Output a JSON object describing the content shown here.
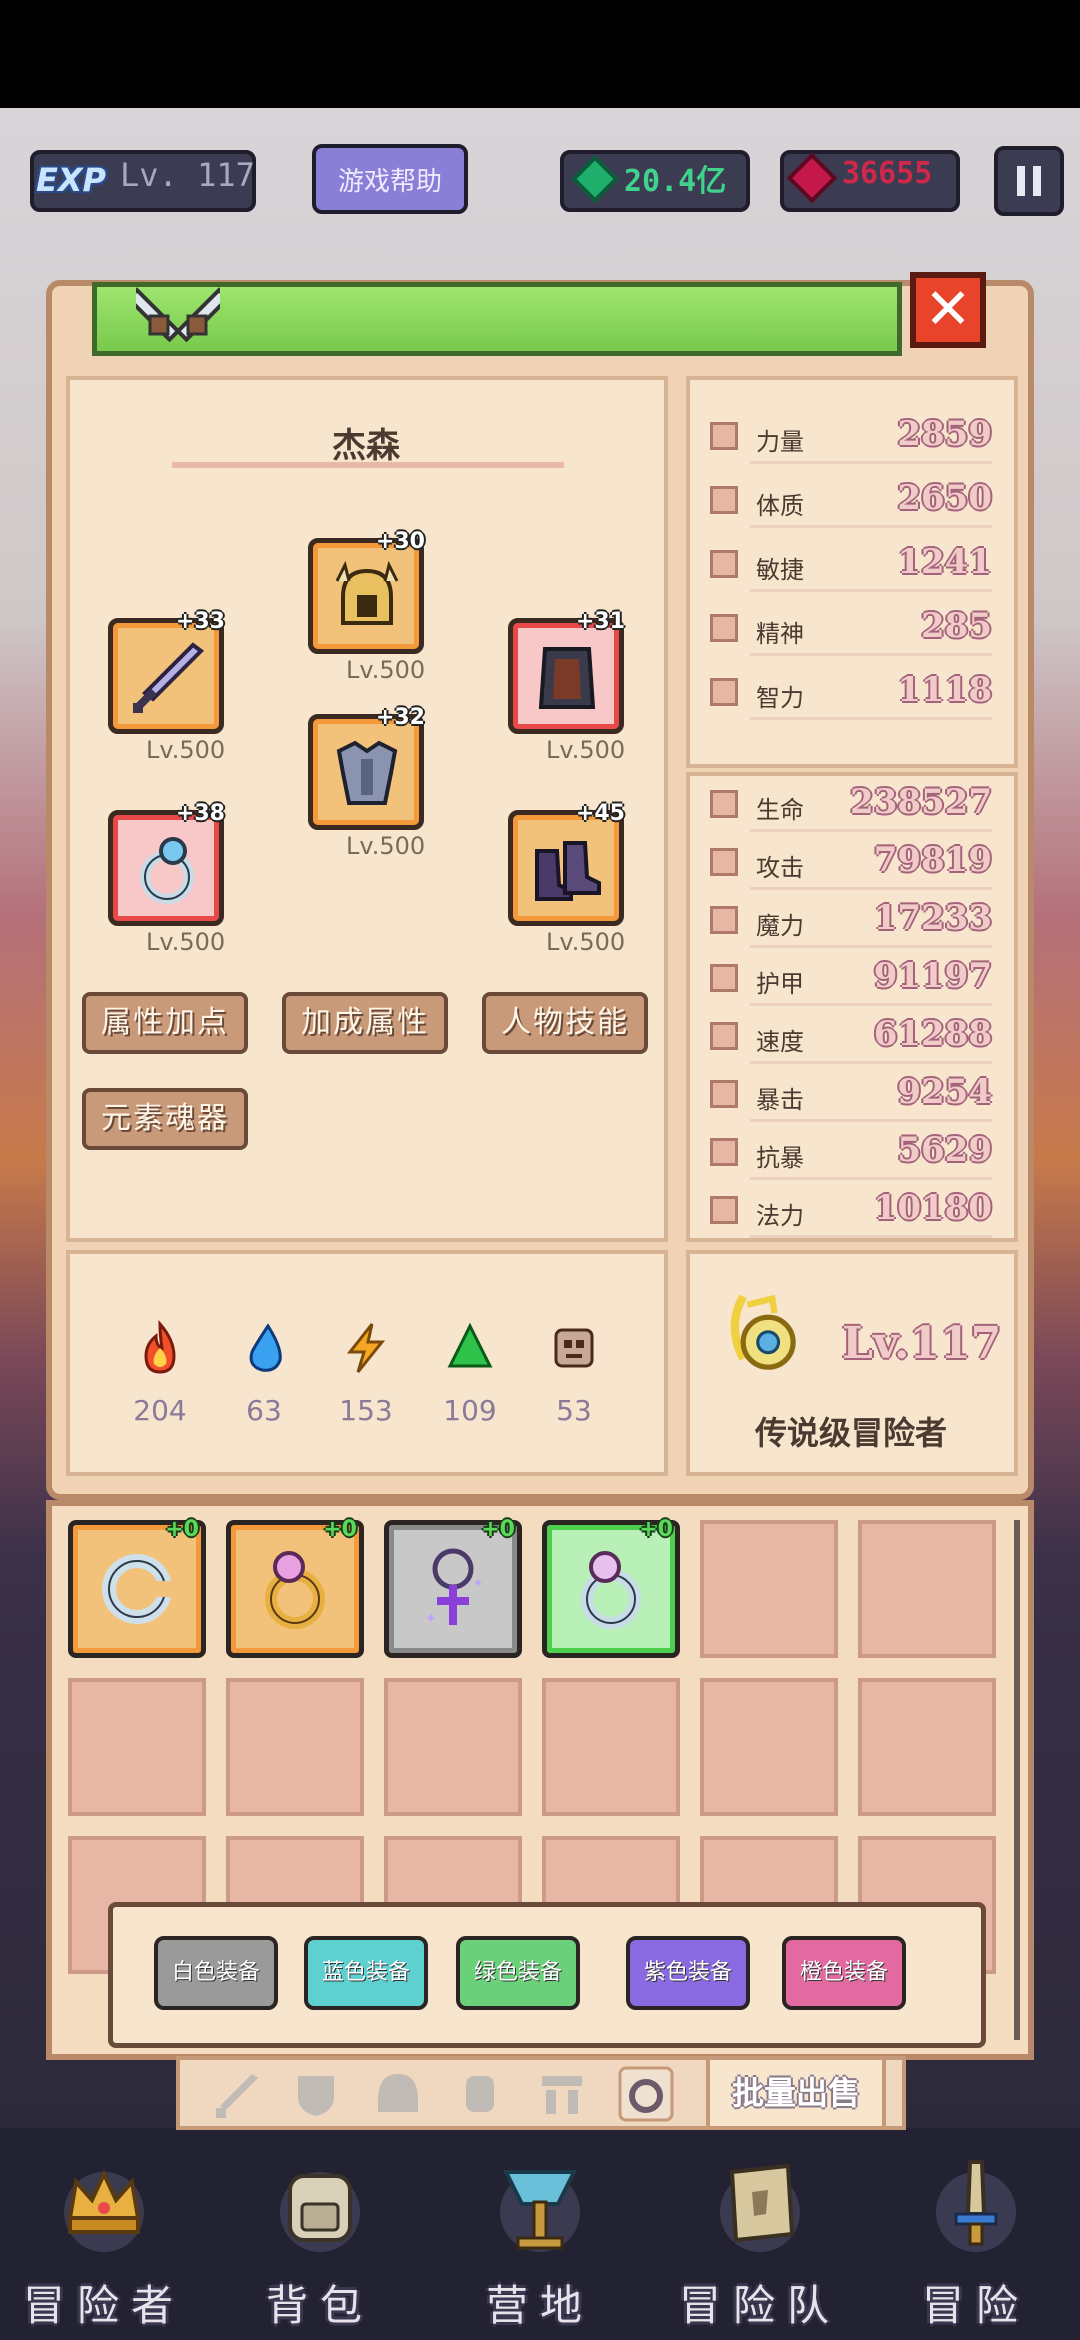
{
  "topbar": {
    "exp_tag": "EXP",
    "level": "Lv. 117",
    "help_button": "游戏帮助",
    "green_gems": "20.4亿",
    "rubies": "36655"
  },
  "character": {
    "name": "杰森",
    "equipment": [
      {
        "slot": "weapon",
        "plus": "+33",
        "level": "Lv.500",
        "icon": "sword-icon"
      },
      {
        "slot": "helmet",
        "plus": "+30",
        "level": "Lv.500",
        "icon": "helmet-icon"
      },
      {
        "slot": "armor",
        "plus": "+32",
        "level": "Lv.500",
        "icon": "chestplate-icon"
      },
      {
        "slot": "cloak",
        "plus": "+31",
        "level": "Lv.500",
        "icon": "cloak-icon"
      },
      {
        "slot": "ring",
        "plus": "+38",
        "level": "Lv.500",
        "icon": "ring-icon"
      },
      {
        "slot": "boots",
        "plus": "+45",
        "level": "Lv.500",
        "icon": "boots-icon"
      }
    ],
    "buttons": {
      "attr_points": "属性加点",
      "bonus_attr": "加成属性",
      "skills": "人物技能",
      "element_soul": "元素魂器"
    },
    "elements": [
      {
        "name": "fire",
        "value": "204",
        "color": "#f0502a"
      },
      {
        "name": "water",
        "value": "63",
        "color": "#3aa0f0"
      },
      {
        "name": "lightning",
        "value": "153",
        "color": "#f5a623"
      },
      {
        "name": "earth",
        "value": "109",
        "color": "#2ec24a"
      },
      {
        "name": "dark",
        "value": "53",
        "color": "#8a6a5a"
      }
    ]
  },
  "base_stats": [
    {
      "label": "力量",
      "value": "2859"
    },
    {
      "label": "体质",
      "value": "2650"
    },
    {
      "label": "敏捷",
      "value": "1241"
    },
    {
      "label": "精神",
      "value": "285"
    },
    {
      "label": "智力",
      "value": "1118"
    }
  ],
  "combat_stats": [
    {
      "label": "生命",
      "value": "238527"
    },
    {
      "label": "攻击",
      "value": "79819"
    },
    {
      "label": "魔力",
      "value": "17233"
    },
    {
      "label": "护甲",
      "value": "91197"
    },
    {
      "label": "速度",
      "value": "61288"
    },
    {
      "label": "暴击",
      "value": "9254"
    },
    {
      "label": "抗暴",
      "value": "5629"
    },
    {
      "label": "法力",
      "value": "10180"
    }
  ],
  "rank": {
    "level": "Lv.117",
    "title": "传说级冒险者"
  },
  "inventory": {
    "items": [
      {
        "plus": "+0",
        "icon": "bracelet-icon"
      },
      {
        "plus": "+0",
        "icon": "gold-ring-icon"
      },
      {
        "plus": "+0",
        "icon": "amulet-icon"
      },
      {
        "plus": "+0",
        "icon": "silver-ring-icon"
      }
    ],
    "filters": [
      {
        "label": "白色装备",
        "color": "#9a9a9a"
      },
      {
        "label": "蓝色装备",
        "color": "#5fd0d0"
      },
      {
        "label": "绿色装备",
        "color": "#6ad07a"
      },
      {
        "label": "紫色装备",
        "color": "#8a6ae0"
      },
      {
        "label": "橙色装备",
        "color": "#e26aa0"
      }
    ],
    "sell_button": "批量出售"
  },
  "nav": [
    {
      "label": "冒险者",
      "icon": "crown-icon"
    },
    {
      "label": "背包",
      "icon": "backpack-icon"
    },
    {
      "label": "营地",
      "icon": "camp-banner-icon"
    },
    {
      "label": "冒险队",
      "icon": "book-icon"
    },
    {
      "label": "冒险",
      "icon": "dagger-icon"
    }
  ]
}
